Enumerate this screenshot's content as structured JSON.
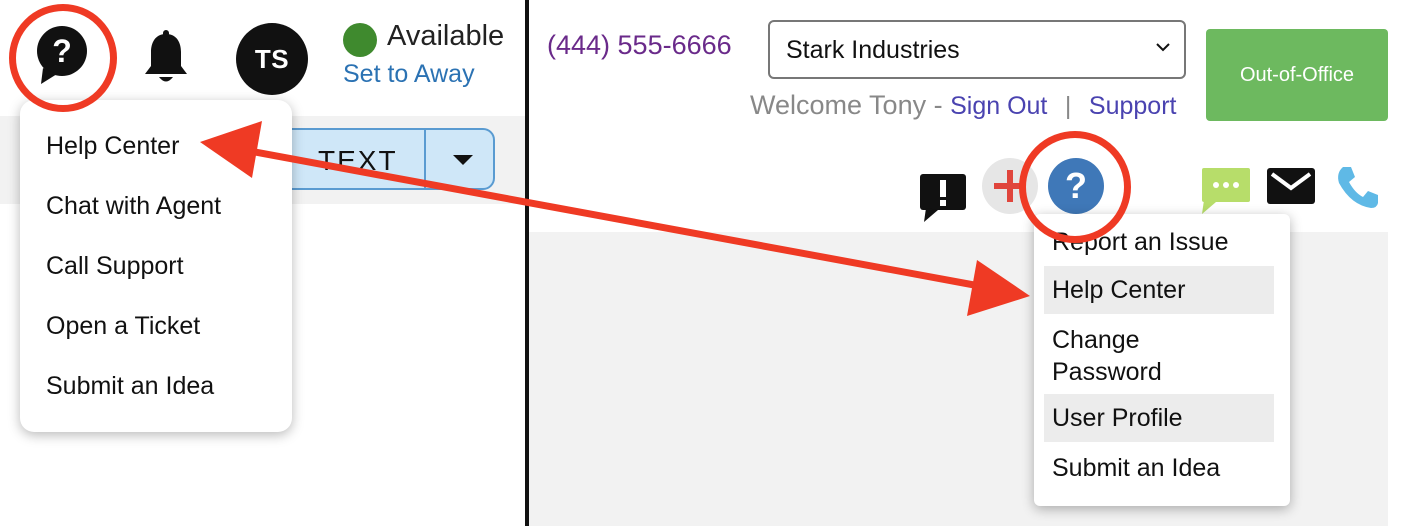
{
  "left": {
    "user_initials": "TS",
    "status_label": "Available",
    "set_away_label": "Set to Away",
    "text_button_label": "TEXT",
    "help_menu": [
      "Help Center",
      "Chat with Agent",
      "Call Support",
      "Open a Ticket",
      "Submit an Idea"
    ]
  },
  "right": {
    "phone_number": "(444) 555-6666",
    "company_select": {
      "value": "Stark Industries"
    },
    "welcome_text": "Welcome Tony -",
    "sign_out_label": "Sign Out",
    "support_label": "Support",
    "out_of_office_label": "Out-of-Office",
    "help_glyph": "?",
    "help_menu": [
      "Report an Issue",
      "Help Center",
      "Change",
      "Password",
      "User Profile",
      "Submit an Idea"
    ]
  },
  "colors": {
    "status_green": "#3f8a2e",
    "link_blue": "#2b72b3",
    "phone_purple": "#6a2a8a",
    "out_of_office_green": "#6db95f",
    "annotation_red": "#ef3a24",
    "text_button_blue": "#cfe7f8"
  },
  "icons": [
    "help-icon",
    "bell-icon",
    "warning-icon",
    "plus-icon",
    "chat-icon",
    "mail-icon",
    "phone-icon"
  ]
}
